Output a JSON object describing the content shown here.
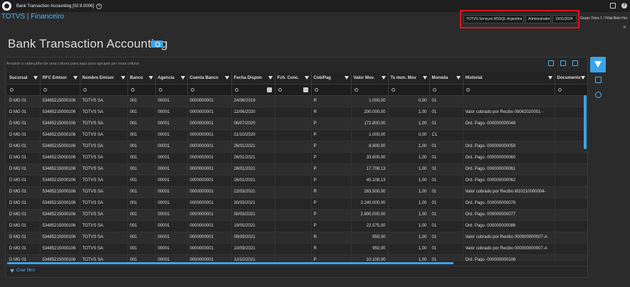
{
  "window": {
    "tab_title": "Bank Transaction Accounting [02.9.0006]",
    "tab_close": "×"
  },
  "header": {
    "brand": "TOTVS | Financeiro",
    "company": "TOTVS Serviços MSSQL Argentina",
    "user": "Administrador",
    "date": "19/11/2024",
    "branch": "Grupo Totvs 1 / Filial Belo Hor",
    "close": "×"
  },
  "page": {
    "title": "Bank Transaction Accounting",
    "group_hint": "Arrastar o cabeçalho de uma coluna para aqui para agrupar por essa coluna"
  },
  "grid": {
    "columns": [
      "Sucursal",
      "RFC Emisor",
      "Nombre Emisor",
      "Banco",
      "Agencia",
      "Cuenta Banco",
      "Fecha Dispon",
      "Fch. Conc.",
      "Cob/Pag",
      "Valor Mov.",
      "Ts mon. Mov",
      "Moneda",
      "Historial",
      "Documento"
    ],
    "rows": [
      [
        "D MG 01",
        "53485215000106",
        "TOTVS SA",
        "001",
        "00001",
        "0000000001",
        "24/06/2019",
        "",
        "R",
        "1.000,00",
        "0,00",
        "01",
        "",
        ""
      ],
      [
        "D MG 01",
        "53485215000106",
        "TOTVS SA",
        "001",
        "00001",
        "0000000001",
        "12/06/2020",
        "",
        "R",
        "200.000,00",
        "1,00",
        "01",
        "Valor cobrado por Recibo 09062020001 -",
        ""
      ],
      [
        "D MG 01",
        "53485215000106",
        "TOTVS SA",
        "001",
        "00001",
        "0000000001",
        "06/07/2020",
        "",
        "P",
        "172.800,00",
        "1,00",
        "01",
        "Ord. Pago. 000000000048",
        ""
      ],
      [
        "D MG 01",
        "53485215000106",
        "TOTVS SA",
        "001",
        "00001",
        "0000000001",
        "21/10/2020",
        "",
        "P",
        "1.000,00",
        "0,00",
        "C1",
        "",
        ""
      ],
      [
        "D MG 01",
        "53485215000106",
        "TOTVS SA",
        "001",
        "00001",
        "0000000001",
        "26/01/2021",
        "",
        "P",
        "8.800,00",
        "1,00",
        "01",
        "Ord. Pago. 000000000059",
        ""
      ],
      [
        "D MG 01",
        "53485215000106",
        "TOTVS SA",
        "001",
        "00001",
        "0000000001",
        "26/01/2021",
        "",
        "P",
        "33.600,00",
        "1,00",
        "01",
        "Ord. Pago. 000000000060",
        ""
      ],
      [
        "D MG 01",
        "53485215000106",
        "TOTVS SA",
        "001",
        "00001",
        "0000000001",
        "26/01/2021",
        "",
        "P",
        "17.708,13",
        "1,00",
        "01",
        "Ord. Pago. 000000000061",
        ""
      ],
      [
        "D MG 01",
        "53485215000106",
        "TOTVS SA",
        "001",
        "00001",
        "0000000001",
        "26/01/2021",
        "",
        "P",
        "45.108,13",
        "1,00",
        "01",
        "Ord. Pago. 000000000062",
        ""
      ],
      [
        "D MG 01",
        "53485215000106",
        "TOTVS SA",
        "001",
        "00001",
        "0000000001",
        "22/03/2021",
        "",
        "R",
        "283.500,00",
        "1,00",
        "01",
        "Valor cobrado por Recibo M10210000004-",
        ""
      ],
      [
        "D MG 01",
        "53485215000106",
        "TOTVS SA",
        "001",
        "00001",
        "0000000001",
        "30/03/2021",
        "",
        "P",
        "2.240.000,00",
        "1,00",
        "01",
        "Ord. Pago. 000000000076",
        ""
      ],
      [
        "D MG 01",
        "53485215000106",
        "TOTVS SA",
        "001",
        "00001",
        "0000000001",
        "30/03/2021",
        "",
        "P",
        "2.800.000,00",
        "1,00",
        "01",
        "Ord. Pago. 000000000077",
        ""
      ],
      [
        "D MG 01",
        "53485215000106",
        "TOTVS SA",
        "001",
        "00001",
        "0000000001",
        "19/05/2021",
        "",
        "P",
        "22.575,00",
        "1,00",
        "01",
        "Ord. Pago. 000000000086",
        ""
      ],
      [
        "D MG 01",
        "53485215000106",
        "TOTVS SA",
        "001",
        "00001",
        "0000000001",
        "09/09/2021",
        "",
        "R",
        "950,00",
        "1,00",
        "01",
        "Valor cobrado por Recibo 000000000007-A",
        ""
      ],
      [
        "D MG 01",
        "53485215000106",
        "TOTVS SA",
        "001",
        "00001",
        "0000000001",
        "10/09/2021",
        "",
        "R",
        "950,00",
        "1,00",
        "01",
        "Valor cobrado por Recibo 000000000007-A",
        ""
      ],
      [
        "D MG 01",
        "53485215000106",
        "TOTVS SA",
        "001",
        "00001",
        "0000000001",
        "12/10/2021",
        "",
        "P",
        "10.100,00",
        "1,00",
        "01",
        "Ord. Pago. 000000000106",
        ""
      ]
    ]
  },
  "footer": {
    "create_filter": "Criar filtro"
  },
  "colors": {
    "accent": "#3aa4e8",
    "brand": "#4fb3ef",
    "highlight_box": "#e0151d"
  }
}
